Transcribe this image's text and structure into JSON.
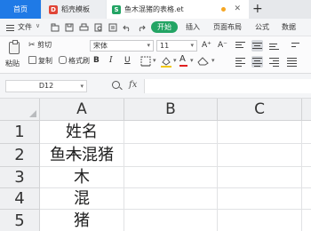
{
  "tabs": {
    "home": "首页",
    "template": "稻壳模板",
    "template_icon": "D",
    "file": "鱼木混猪的表格.et",
    "file_icon": "S",
    "add": "+"
  },
  "menu": {
    "file": "文件",
    "caret": "∨",
    "start": "开始",
    "insert": "插入",
    "page_layout": "页面布局",
    "formula": "公式",
    "data": "数据"
  },
  "ribbon": {
    "paste": "粘贴",
    "cut": "剪切",
    "copy": "复制",
    "format_painter": "格式刷",
    "font_name": "宋体",
    "font_size": "11",
    "bold": "B",
    "italic": "I",
    "underline": "U",
    "grow_font": "A⁺",
    "shrink_font": "A⁻"
  },
  "formula_bar": {
    "name_box": "D12",
    "fx": "fx",
    "formula": ""
  },
  "grid": {
    "columns": [
      "A",
      "B",
      "C"
    ],
    "rows": [
      "1",
      "2",
      "3",
      "4",
      "5"
    ],
    "row2_strike": "木",
    "cells_a": [
      "姓名",
      "鱼",
      "木",
      "混",
      "猪"
    ],
    "cell_a2_before": "鱼",
    "cell_a2_after": "混猪"
  },
  "colors": {
    "accent_blue": "#1f7ae6",
    "accent_green": "#23a464",
    "template_red": "#e04436"
  }
}
